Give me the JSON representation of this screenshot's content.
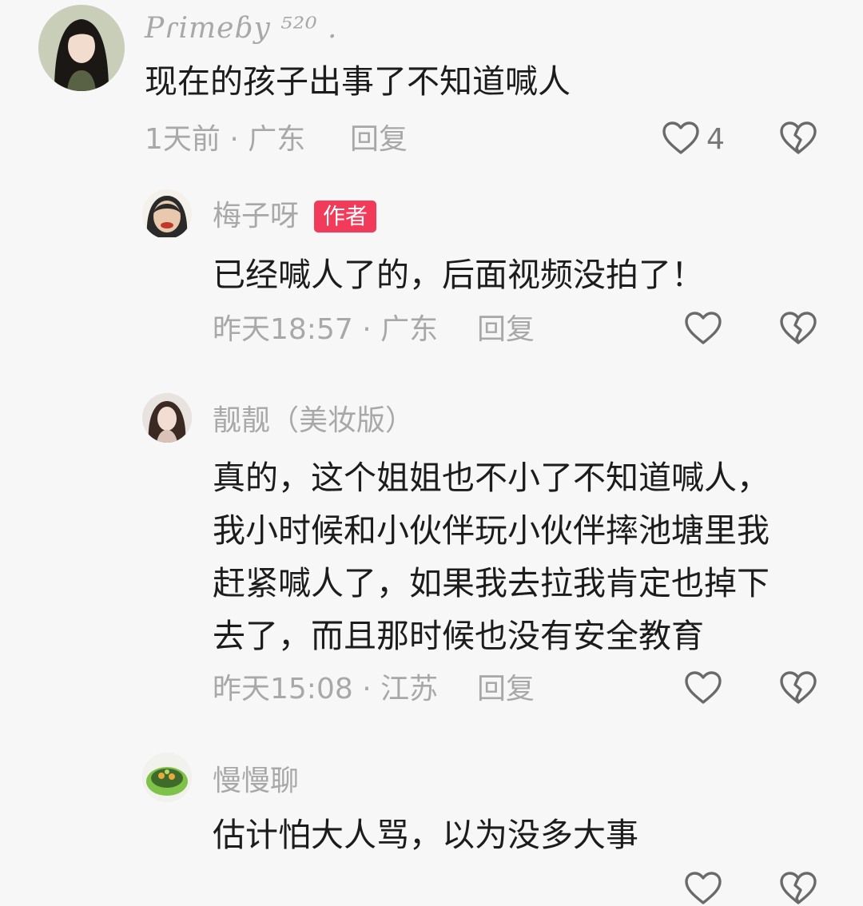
{
  "comments": [
    {
      "username": "Pɾimeɓy ⁵²⁰ .",
      "text": "现在的孩子出事了不知道喊人",
      "meta": "1天前 · 广东",
      "reply": "回复",
      "likes": "4"
    },
    {
      "username": "梅子呀",
      "badge": "作者",
      "text": "已经喊人了的，后面视频没拍了！",
      "meta": "昨天18:57 · 广东",
      "reply": "回复"
    },
    {
      "username": "靓靓（美妆版）",
      "text_lines": [
        "真的，这个姐姐也不小了不知道喊人，",
        "我小时候和小伙伴玩小伙伴摔池塘里我",
        "赶紧喊人了，如果我去拉我肯定也掉下",
        "去了，而且那时候也没有安全教育"
      ],
      "meta": "昨天15:08 · 江苏",
      "reply": "回复"
    },
    {
      "username": "慢慢聊",
      "text": "估计怕大人骂，以为没多大事"
    }
  ],
  "icons": {
    "like": "heart-outline-icon",
    "dislike": "broken-heart-icon"
  },
  "colors": {
    "background": "#f7f7f7",
    "muted": "#a8a8a8",
    "author_badge": "#f23a5a"
  }
}
